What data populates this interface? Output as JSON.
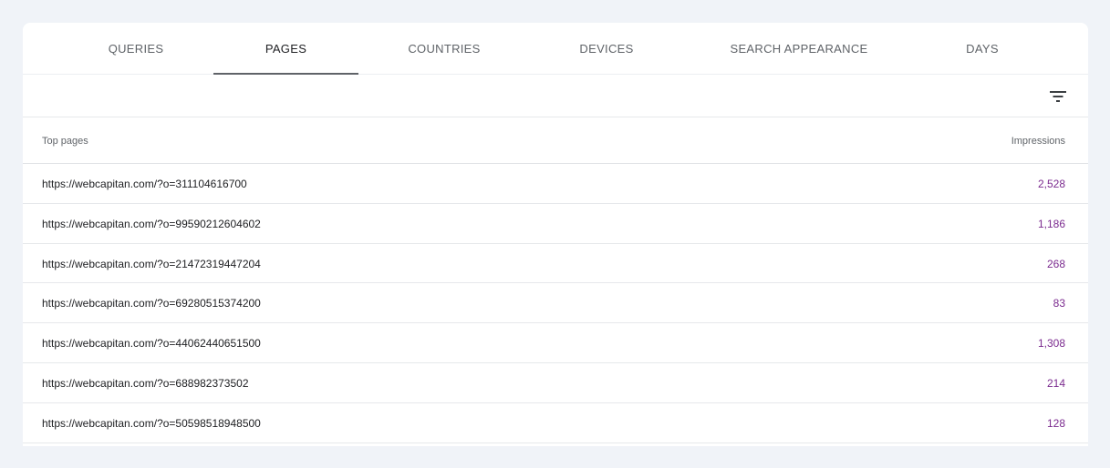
{
  "tabs": [
    {
      "label": "QUERIES",
      "active": false
    },
    {
      "label": "PAGES",
      "active": true
    },
    {
      "label": "COUNTRIES",
      "active": false
    },
    {
      "label": "DEVICES",
      "active": false
    },
    {
      "label": "SEARCH APPEARANCE",
      "active": false
    },
    {
      "label": "DAYS",
      "active": false
    }
  ],
  "toolbar": {
    "filter_icon": "filter-icon"
  },
  "table": {
    "header": {
      "left": "Top pages",
      "right": "Impressions"
    },
    "rows": [
      {
        "url": "https://webcapitan.com/?o=311104616700",
        "impressions": "2,528"
      },
      {
        "url": "https://webcapitan.com/?o=99590212604602",
        "impressions": "1,186"
      },
      {
        "url": "https://webcapitan.com/?o=21472319447204",
        "impressions": "268"
      },
      {
        "url": "https://webcapitan.com/?o=69280515374200",
        "impressions": "83"
      },
      {
        "url": "https://webcapitan.com/?o=44062440651500",
        "impressions": "1,308"
      },
      {
        "url": "https://webcapitan.com/?o=688982373502",
        "impressions": "214"
      },
      {
        "url": "https://webcapitan.com/?o=50598518948500",
        "impressions": "128"
      }
    ]
  },
  "colors": {
    "background": "#f0f3f8",
    "impressions": "#7b2b8f",
    "tab_indicator": "#5f6368"
  }
}
